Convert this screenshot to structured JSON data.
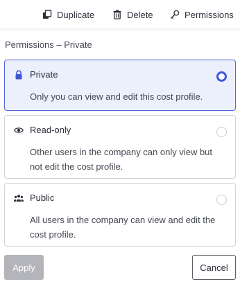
{
  "toolbar": {
    "duplicate_label": "Duplicate",
    "duplicate_icon": "copy-icon",
    "delete_label": "Delete",
    "delete_icon": "trash-icon",
    "permissions_label": "Permissions",
    "permissions_icon": "key-icon"
  },
  "panel": {
    "title": "Permissions – Private",
    "selected": "private",
    "options": [
      {
        "id": "private",
        "label": "Private",
        "icon": "lock-icon",
        "description": "Only you can view and edit this cost profile.",
        "selected": true
      },
      {
        "id": "read-only",
        "label": "Read-only",
        "icon": "eye-icon",
        "description": "Other users in the company can only view but not edit the cost profile.",
        "selected": false
      },
      {
        "id": "public",
        "label": "Public",
        "icon": "people-icon",
        "description": "All users in the company can view and edit the cost profile.",
        "selected": false
      }
    ]
  },
  "actions": {
    "apply_label": "Apply",
    "apply_disabled": true,
    "cancel_label": "Cancel"
  },
  "colors": {
    "accent": "#3e56d6",
    "selected_bg": "#eceffc",
    "disabled_button": "#b4b5ba"
  }
}
